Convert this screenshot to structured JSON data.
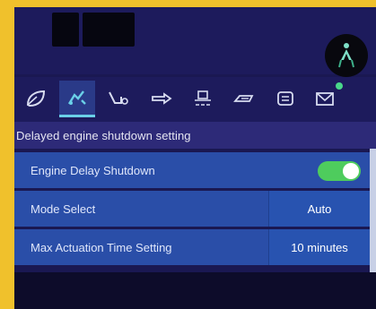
{
  "header": {
    "left_blocks": [
      "",
      ""
    ],
    "machine_status_icon": "excavator-status-icon"
  },
  "tabs": [
    {
      "icon": "leaf-icon",
      "active": false
    },
    {
      "icon": "excavator-arm-icon",
      "active": true
    },
    {
      "icon": "bucket-icon",
      "active": false
    },
    {
      "icon": "arrow-tool-icon",
      "active": false
    },
    {
      "icon": "engine-idle-icon",
      "active": false
    },
    {
      "icon": "hydraulic-icon",
      "active": false
    },
    {
      "icon": "menu-icon",
      "active": false
    },
    {
      "icon": "mail-icon",
      "active": false,
      "notification": true
    }
  ],
  "section": {
    "title": "Delayed engine shutdown setting"
  },
  "settings": {
    "engine_delay": {
      "label": "Engine Delay Shutdown",
      "enabled": true
    },
    "mode_select": {
      "label": "Mode Select",
      "value": "Auto"
    },
    "max_time": {
      "label": "Max Actuation Time Setting",
      "value": "10 minutes"
    }
  },
  "colors": {
    "toggle_on": "#4ecc5d",
    "row_bg": "#2a4ea8",
    "active_tab_accent": "#6ad0e8",
    "notification_dot": "#49d88a"
  }
}
